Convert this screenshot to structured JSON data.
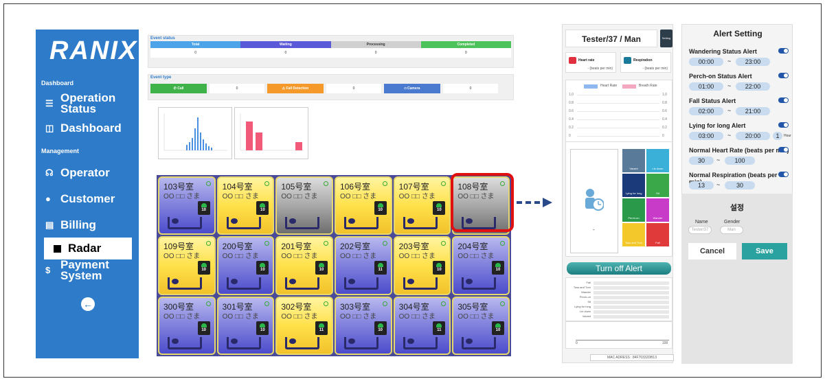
{
  "sidebar": {
    "logo": "RANIX",
    "sections": {
      "dashboard": "Dashboard",
      "management": "Management"
    },
    "items": [
      {
        "label_line1": "Operation",
        "label_line2": "Status",
        "icon": "list-icon"
      },
      {
        "label": "Dashboard",
        "icon": "columns-icon"
      },
      {
        "label": "Operator",
        "icon": "headset-icon"
      },
      {
        "label": "Customer",
        "icon": "user-icon"
      },
      {
        "label": "Billing",
        "icon": "document-icon"
      },
      {
        "label": "Radar",
        "icon": "square-icon"
      },
      {
        "label_line1": "Payment",
        "label_line2": "System",
        "icon": "dollar-icon"
      }
    ],
    "back_icon": "arrow-left-icon"
  },
  "event_status": {
    "title": "Event status",
    "columns": [
      "Total",
      "Waiting",
      "Processing",
      "Completed"
    ],
    "values": [
      "0",
      "0",
      "0",
      "0"
    ],
    "colors": [
      "#4da3e8",
      "#5a5ad8",
      "#d0d0d0",
      "#4cc25a"
    ]
  },
  "event_type": {
    "title": "Event type",
    "items": [
      {
        "label": "Call",
        "value": "0",
        "color": "#3fb24a"
      },
      {
        "label": "Fall Detection",
        "value": "0",
        "color": "#f59a2a"
      },
      {
        "label": "Camera",
        "value": "0",
        "color": "#4a7ad0"
      }
    ]
  },
  "rooms": [
    {
      "name": "103号室",
      "sub": "OO □□ さま",
      "color": "purple",
      "badge": "10"
    },
    {
      "name": "104号室",
      "sub": "OO □□ さま",
      "color": "yellow",
      "badge": "10"
    },
    {
      "name": "105号室",
      "sub": "OO □□ さま",
      "color": "gray",
      "badge": ""
    },
    {
      "name": "106号室",
      "sub": "OO □□ さま",
      "color": "yellow",
      "badge": "10"
    },
    {
      "name": "107号室",
      "sub": "OO □□ さま",
      "color": "yellow",
      "badge": "10"
    },
    {
      "name": "108号室",
      "sub": "OO □□ さま",
      "color": "gray",
      "badge": ""
    },
    {
      "name": "109号室",
      "sub": "OO □□ さま",
      "color": "yellow",
      "badge": "10"
    },
    {
      "name": "200号室",
      "sub": "OO □□ さま",
      "color": "purple",
      "badge": "10"
    },
    {
      "name": "201号室",
      "sub": "OO □□ さま",
      "color": "yellow",
      "badge": "10"
    },
    {
      "name": "202号室",
      "sub": "OO □□ さま",
      "color": "purple",
      "badge": "11"
    },
    {
      "name": "203号室",
      "sub": "OO □□ さま",
      "color": "yellow",
      "badge": "10"
    },
    {
      "name": "204号室",
      "sub": "OO □□ さま",
      "color": "purple",
      "badge": "10"
    },
    {
      "name": "300号室",
      "sub": "OO □□ さま",
      "color": "purple",
      "badge": "10"
    },
    {
      "name": "301号室",
      "sub": "OO □□ さま",
      "color": "purple",
      "badge": "10"
    },
    {
      "name": "302号室",
      "sub": "OO □□ さま",
      "color": "yellow",
      "badge": "11"
    },
    {
      "name": "303号室",
      "sub": "OO □□ さま",
      "color": "purple",
      "badge": "10"
    },
    {
      "name": "304号室",
      "sub": "OO □□ さま",
      "color": "purple",
      "badge": "11"
    },
    {
      "name": "305号室",
      "sub": "OO □□ さま",
      "color": "purple",
      "badge": "10"
    }
  ],
  "detail": {
    "title": "Tester/37 / Man",
    "setting_label": "Setting",
    "heart": {
      "label": "Heart rate",
      "unit": "- (beats per min)"
    },
    "resp": {
      "label": "Respiration",
      "unit": "- (beats per min)"
    },
    "legend": [
      "Heart Rate",
      "Breath Rate"
    ],
    "yticks": [
      "1.0",
      "0.8",
      "0.6",
      "0.4",
      "0.2",
      "0"
    ],
    "status_tiles": [
      "Vacant",
      "Lie down",
      "Lying for long",
      "Sit",
      "Perch-on",
      "Wander",
      "Toss and Turn",
      "Fall"
    ],
    "dash": "-",
    "turn_off": "Turn off Alert",
    "hbar_labels": [
      "Fall",
      "Toss and Turn",
      "Wander",
      "Perch-on",
      "Sit",
      "Lying for long",
      "Lie down",
      "Vacant"
    ],
    "axis": [
      "0",
      "100"
    ],
    "mac": "MAC ADRESS : 84F70332DB13"
  },
  "alert": {
    "title": "Alert Setting",
    "rows": [
      {
        "label": "Wandering Status Alert",
        "from": "00:00",
        "to": "23:00"
      },
      {
        "label": "Perch-on Status Alert",
        "from": "01:00",
        "to": "22:00"
      },
      {
        "label": "Fall Status Alert",
        "from": "02:00",
        "to": "21:00"
      },
      {
        "label": "Lying for long Alert",
        "from": "03:00",
        "to": "20:00",
        "extra": "1",
        "extra_unit": "Hour"
      },
      {
        "label": "Normal Heart Rate (beats per min)",
        "from": "30",
        "to": "100"
      },
      {
        "label": "Normal Respiration (beats per min)",
        "from": "13",
        "to": "30"
      }
    ],
    "tilde": "~"
  },
  "save_panel": {
    "title": "설정",
    "name_label": "Name",
    "gender_label": "Gender",
    "name_value": "Tester/37",
    "gender_value": "Man",
    "cancel": "Cancel",
    "save": "Save"
  }
}
